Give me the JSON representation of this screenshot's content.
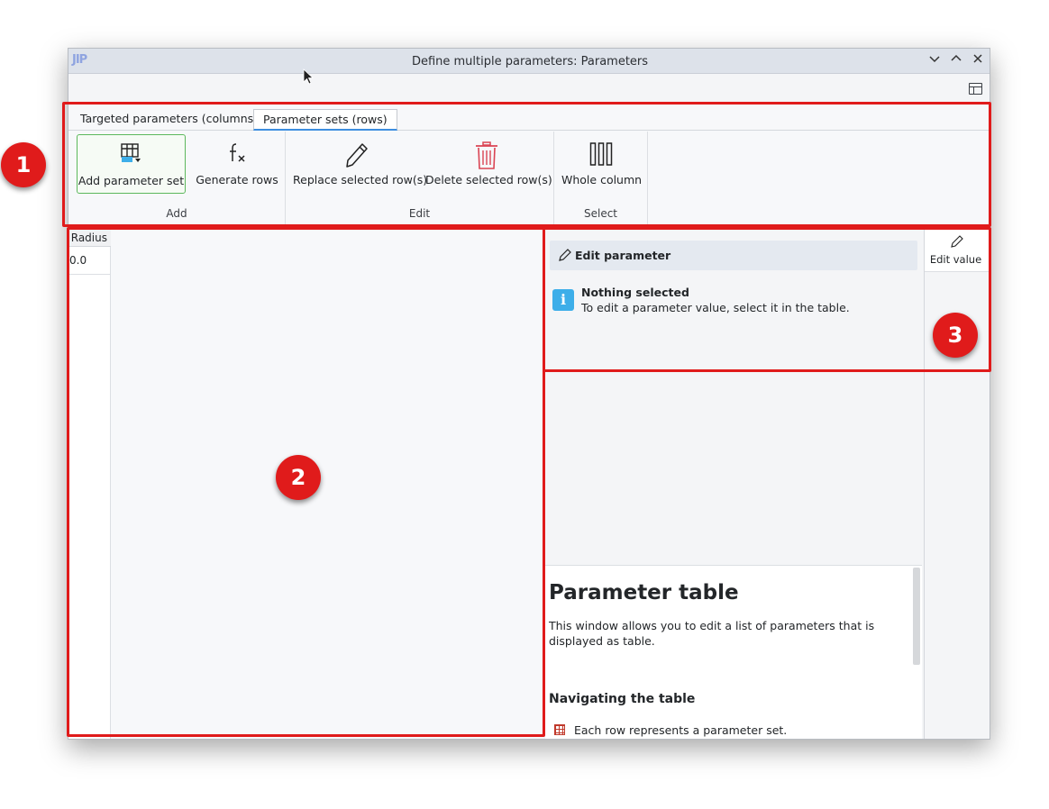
{
  "window": {
    "logo": "JIP",
    "title": "Define multiple parameters: Parameters"
  },
  "ribbon": {
    "tabs": [
      {
        "label": "Targeted parameters (columns)"
      },
      {
        "label": "Parameter sets (rows)"
      }
    ],
    "groups": {
      "add": {
        "label": "Add",
        "buttons": {
          "add_parameter_set": "Add parameter set",
          "generate_rows": "Generate rows"
        }
      },
      "edit": {
        "label": "Edit",
        "buttons": {
          "replace_rows": "Replace selected row(s)",
          "delete_rows": "Delete selected row(s)"
        }
      },
      "select": {
        "label": "Select",
        "buttons": {
          "whole_column": "Whole column"
        }
      }
    }
  },
  "table": {
    "column_header": "Radius",
    "cell_value": "0.0"
  },
  "edit_panel": {
    "header": "Edit parameter",
    "nothing_selected_title": "Nothing selected",
    "nothing_selected_desc": "To edit a parameter value, select it in the table."
  },
  "help": {
    "title": "Parameter table",
    "intro": "This window allows you to edit a list of parameters that is displayed as table.",
    "section_title": "Navigating the table",
    "bullet_1": "Each row represents a parameter set."
  },
  "side_tabs": {
    "edit_value": "Edit value"
  },
  "annotations": {
    "badge_1": "1",
    "badge_2": "2",
    "badge_3": "3",
    "highlight_color": "#e01b1b"
  },
  "colors": {
    "accent": "#3d8ee0",
    "selected_border": "#5cb85c",
    "info": "#3daee9",
    "delete": "#da4453"
  }
}
